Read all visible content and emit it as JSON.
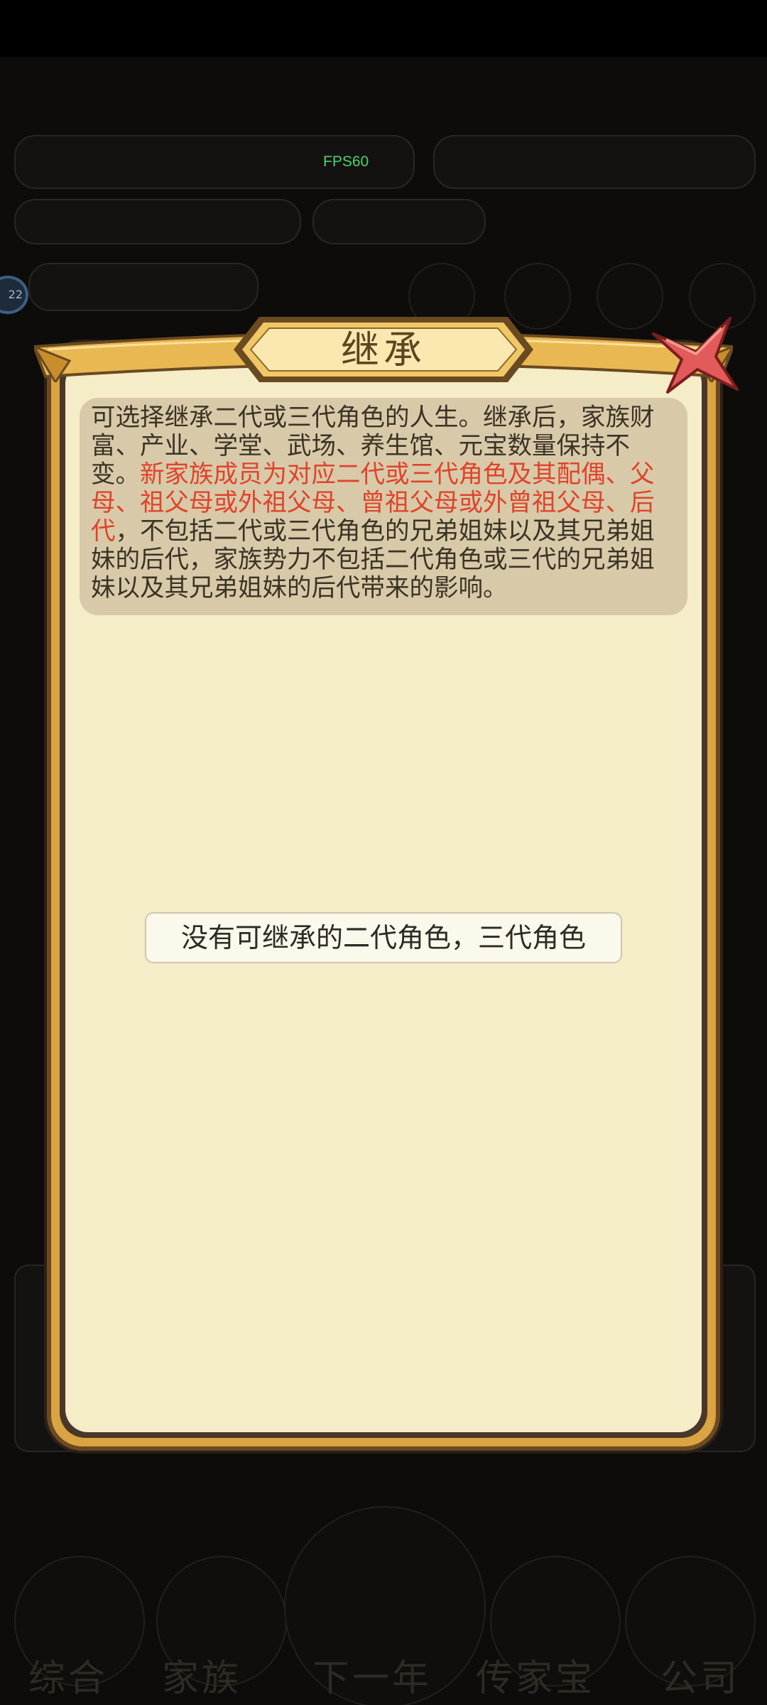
{
  "overlay": {
    "fps_label": "FPS60",
    "avatar_badge": "22"
  },
  "background": {
    "bottom_nav": [
      "综合",
      "家族",
      "下一年",
      "传家宝",
      "公司"
    ]
  },
  "dialog": {
    "title": "继承",
    "close_icon": "close-x-icon",
    "info_text_part1": "可选择继承二代或三代角色的人生。继承后，家族财富、产业、学堂、武场、养生馆、元宝数量保持不变。",
    "info_text_highlight": "新家族成员为对应二代或三代角色及其配偶、父母、祖父母或外祖父母、曾祖父母或外曾祖父母、后代",
    "info_text_part2": "，不包括二代或三代角色的兄弟姐妹以及其兄弟姐妹的后代，家族势力不包括二代角色或三代的兄弟姐妹以及其兄弟姐妹的后代带来的影响。",
    "empty_message": "没有可继承的二代角色，三代角色"
  },
  "colors": {
    "frame_gold": "#d9a441",
    "body_cream": "#f5ecc8",
    "info_bg": "#d8caa8",
    "highlight_red": "#e0432c",
    "fps_green": "#4ed16a"
  }
}
